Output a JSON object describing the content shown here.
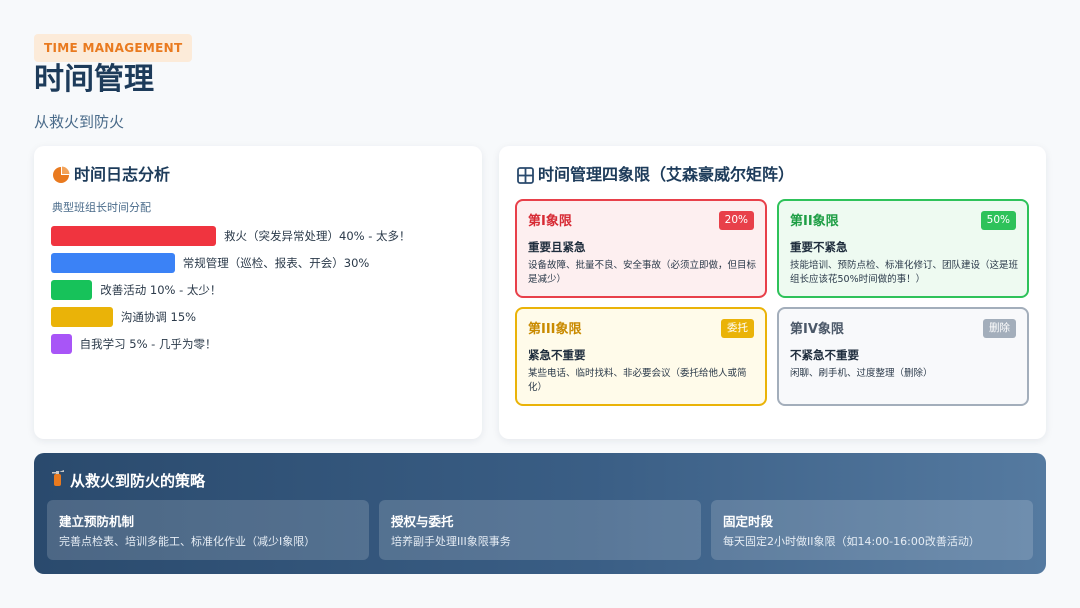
{
  "header": {
    "tag": "TIME MANAGEMENT",
    "title": "时间管理",
    "subtitle": "从救火到防火"
  },
  "log_card": {
    "title": "时间日志分析",
    "icon": "pie-chart-icon",
    "dist_label": "典型班组长时间分配",
    "bars": [
      {
        "label": "救火（突发异常处理）40% - 太多！",
        "percent": 40,
        "color": "#f0343f"
      },
      {
        "label": "常规管理（巡检、报表、开会）30%",
        "percent": 30,
        "color": "#3b82f6"
      },
      {
        "label": "改善活动 10% - 太少！",
        "percent": 10,
        "color": "#17c25a"
      },
      {
        "label": "沟通协调 15%",
        "percent": 15,
        "color": "#eab308"
      },
      {
        "label": "自我学习 5% - 几乎为零！",
        "percent": 5,
        "color": "#a855f7"
      }
    ]
  },
  "quadrant_card": {
    "title": "时间管理四象限（艾森豪威尔矩阵）",
    "icon": "grid-icon",
    "quadrants": [
      {
        "title": "第I象限",
        "badge": "20%",
        "heading": "重要且紧急",
        "desc": "设备故障、批量不良、安全事故（必须立即做，但目标是减少）"
      },
      {
        "title": "第II象限",
        "badge": "50%",
        "heading": "重要不紧急",
        "desc": "技能培训、预防点检、标准化修订、团队建设（这是班组长应该花50%时间做的事！）"
      },
      {
        "title": "第III象限",
        "badge": "委托",
        "heading": "紧急不重要",
        "desc": "某些电话、临时找料、非必要会议（委托给他人或简化）"
      },
      {
        "title": "第IV象限",
        "badge": "删除",
        "heading": "不紧急不重要",
        "desc": "闲聊、刷手机、过度整理（删除）"
      }
    ]
  },
  "strategy": {
    "title": "从救火到防火的策略",
    "icon": "fire-extinguisher-icon",
    "items": [
      {
        "title": "建立预防机制",
        "desc": "完善点检表、培训多能工、标准化作业（减少I象限）"
      },
      {
        "title": "授权与委托",
        "desc": "培养副手处理III象限事务"
      },
      {
        "title": "固定时段",
        "desc": "每天固定2小时做II象限（如14:00-16:00改善活动）"
      }
    ]
  }
}
